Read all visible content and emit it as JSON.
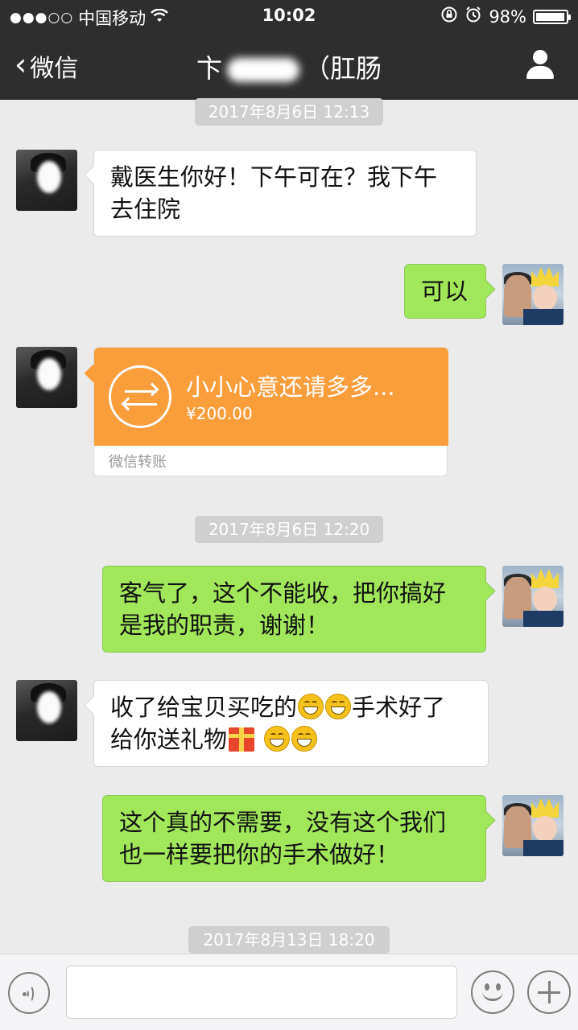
{
  "status_bar": {
    "signal_dots": "●●●○○",
    "carrier": "中国移动",
    "time": "10:02",
    "battery_percent": "98%",
    "battery_level": 0.98
  },
  "nav": {
    "back_label": "微信",
    "title_prefix": "卞",
    "title_suffix": "（肛肠"
  },
  "messages": [
    {
      "timestamp": "2017年8月6日 12:13"
    },
    {
      "side": "left",
      "text_lines": [
        "戴医生你好！下午可在？我下午",
        "去住院"
      ]
    },
    {
      "side": "right",
      "text_lines": [
        "可以"
      ]
    },
    {
      "side": "left",
      "type": "transfer",
      "title": "小小心意还请多多...",
      "amount": "¥200.00",
      "footer": "微信转账"
    },
    {
      "timestamp": "2017年8月6日 12:20"
    },
    {
      "side": "right",
      "text_lines": [
        "客气了，这个不能收，把你搞好",
        "是我的职责，谢谢！"
      ]
    },
    {
      "side": "left",
      "segments_line1": [
        "收了给宝贝买吃的",
        "手术好了"
      ],
      "segments_line2": [
        "给你送礼物"
      ],
      "emojis": [
        "grin-icon",
        "gift-icon"
      ]
    },
    {
      "side": "right",
      "text_lines": [
        "这个真的不需要，没有这个我们",
        "也一样要把你的手术做好！"
      ]
    },
    {
      "timestamp": "2017年8月13日 18:20"
    }
  ],
  "colors": {
    "nav_bg": "#2e2e2e",
    "chat_bg": "#ebebeb",
    "sent_bubble": "#a0e75a",
    "received_bubble": "#ffffff",
    "transfer_orange": "#fa9d3b"
  }
}
